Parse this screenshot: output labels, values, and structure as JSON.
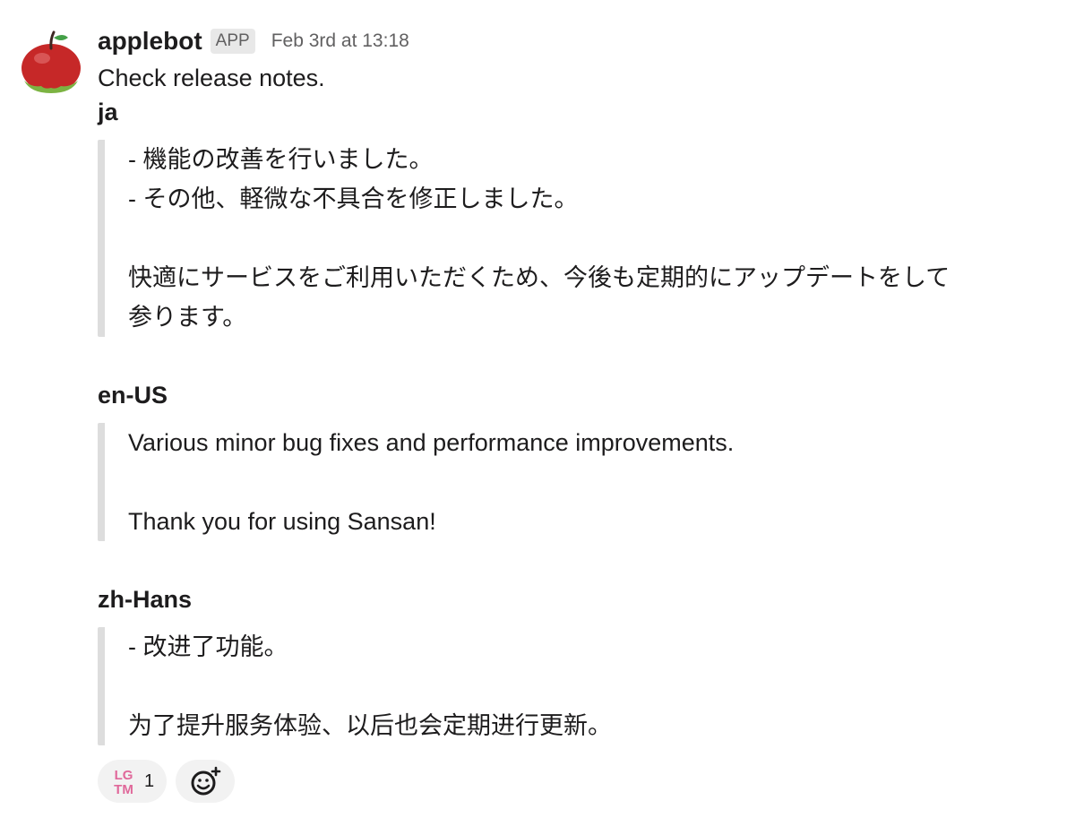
{
  "message": {
    "username": "applebot",
    "badge": "APP",
    "timestamp": "Feb 3rd at 13:18",
    "intro": "Check release notes."
  },
  "sections": [
    {
      "heading": "ja",
      "lines": [
        "- 機能の改善を行いました。",
        "- その他、軽微な不具合を修正しました。",
        "",
        "快適にサービスをご利用いただくため、今後も定期的にアップデートをして",
        "参ります。"
      ]
    },
    {
      "heading": "en-US",
      "lines": [
        "Various minor bug fixes and performance improvements.",
        "",
        "Thank you for using Sansan!"
      ]
    },
    {
      "heading": "zh-Hans",
      "lines": [
        "- 改进了功能。",
        "",
        "为了提升服务体验、以后也会定期进行更新。"
      ]
    }
  ],
  "reactions": [
    {
      "emoji_text": "LGTM",
      "emoji_top": "LG",
      "emoji_bottom": "TM",
      "count": "1",
      "color": "#e0689a"
    }
  ],
  "icons": {
    "avatar": "apple-icon",
    "add_reaction": "add-emoji-icon"
  }
}
